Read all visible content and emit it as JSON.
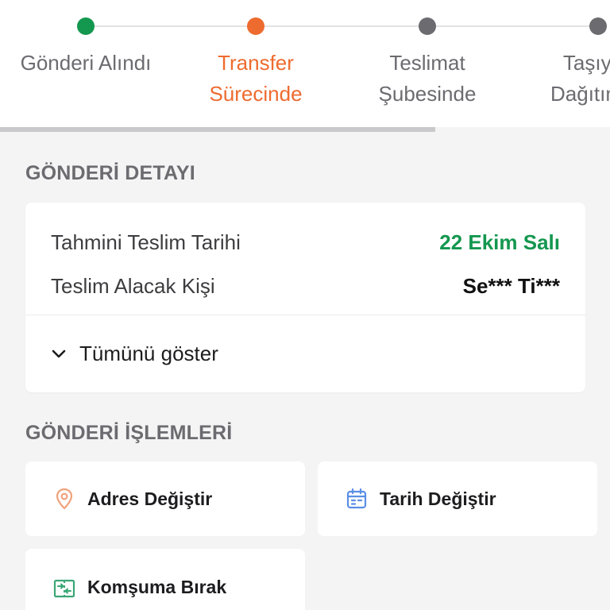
{
  "colors": {
    "done": "#14974f",
    "active": "#ee6b2f",
    "pending": "#6b6b70",
    "eta": "#14974f",
    "pin_icon": "#f0a27a",
    "calendar_icon": "#5b8ee6",
    "swap_icon": "#3aa676"
  },
  "stepper": {
    "steps": [
      {
        "label": "Gönderi Alındı",
        "status": "done"
      },
      {
        "label": "Transfer Sürecinde",
        "status": "active"
      },
      {
        "label": "Teslimat Şubesinde",
        "status": "pending"
      },
      {
        "label": "Taşıyıcı Dağıtımda",
        "status": "pending"
      }
    ],
    "progress": 0.714
  },
  "details": {
    "section_title": "GÖNDERİ DETAYI",
    "rows": [
      {
        "label": "Tahmini Teslim Tarihi",
        "value": "22 Ekim Salı"
      },
      {
        "label": "Teslim Alacak Kişi",
        "value": "Se*** Ti***"
      }
    ],
    "expand_label": "Tümünü göster",
    "expand_icon": "chevron-down-icon"
  },
  "actions": {
    "section_title": "GÖNDERİ İŞLEMLERİ",
    "items": [
      {
        "label": "Adres Değiştir",
        "icon": "location-pin-icon"
      },
      {
        "label": "Tarih Değiştir",
        "icon": "calendar-icon"
      },
      {
        "label": "Komşuma Bırak",
        "icon": "swap-icon"
      }
    ]
  }
}
